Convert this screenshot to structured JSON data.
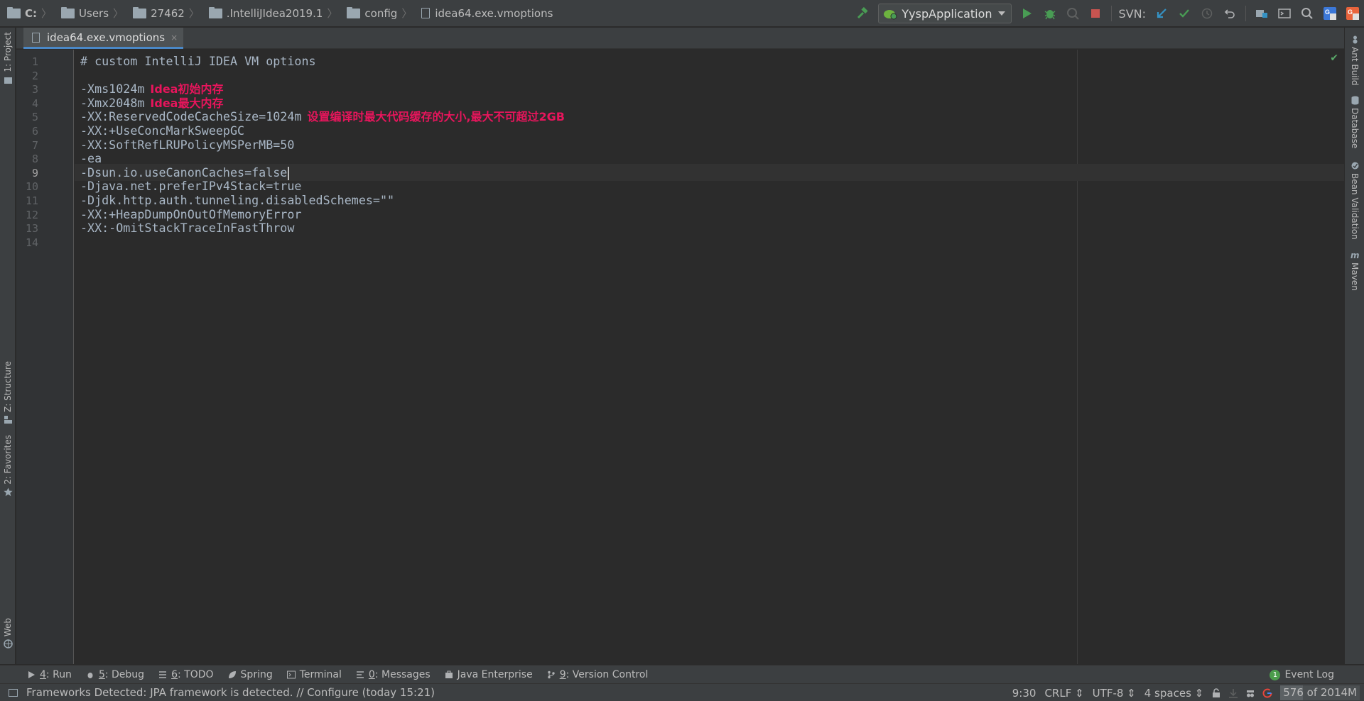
{
  "breadcrumbs": [
    {
      "label": "C:",
      "icon": "folder-icon",
      "bold": true
    },
    {
      "label": "Users",
      "icon": "folder-icon"
    },
    {
      "label": "27462",
      "icon": "folder-icon"
    },
    {
      "label": ".IntelliJIdea2019.1",
      "icon": "folder-icon"
    },
    {
      "label": "config",
      "icon": "folder-icon"
    },
    {
      "label": "idea64.exe.vmoptions",
      "icon": "file-icon"
    }
  ],
  "toolbar": {
    "run_config": "YyspApplication",
    "svn_label": "SVN:"
  },
  "left_tabs": {
    "project": "1: Project",
    "structure": "Z: Structure",
    "favorites": "2: Favorites",
    "web": "Web"
  },
  "right_tabs": {
    "ant": "Ant Build",
    "database": "Database",
    "bean": "Bean Validation",
    "maven": "Maven"
  },
  "editor_tab": {
    "label": "idea64.exe.vmoptions",
    "close": "×"
  },
  "editor": {
    "current_line": 9,
    "lines": [
      {
        "n": "1",
        "text": "# custom IntelliJ IDEA VM options",
        "ann": ""
      },
      {
        "n": "2",
        "text": "",
        "ann": ""
      },
      {
        "n": "3",
        "text": "-Xms1024m",
        "ann": "Idea初始内存"
      },
      {
        "n": "4",
        "text": "-Xmx2048m",
        "ann": "Idea最大内存"
      },
      {
        "n": "5",
        "text": "-XX:ReservedCodeCacheSize=1024m",
        "ann": "设置编译时最大代码缓存的大小,最大不可超过2GB"
      },
      {
        "n": "6",
        "text": "-XX:+UseConcMarkSweepGC",
        "ann": ""
      },
      {
        "n": "7",
        "text": "-XX:SoftRefLRUPolicyMSPerMB=50",
        "ann": ""
      },
      {
        "n": "8",
        "text": "-ea",
        "ann": ""
      },
      {
        "n": "9",
        "text": "-Dsun.io.useCanonCaches=false",
        "ann": ""
      },
      {
        "n": "10",
        "text": "-Djava.net.preferIPv4Stack=true",
        "ann": ""
      },
      {
        "n": "11",
        "text": "-Djdk.http.auth.tunneling.disabledSchemes=\"\"",
        "ann": ""
      },
      {
        "n": "12",
        "text": "-XX:+HeapDumpOnOutOfMemoryError",
        "ann": ""
      },
      {
        "n": "13",
        "text": "-XX:-OmitStackTraceInFastThrow",
        "ann": ""
      },
      {
        "n": "14",
        "text": "",
        "ann": ""
      }
    ]
  },
  "bottom_tabs": {
    "run": {
      "key": "4",
      "label": ": Run"
    },
    "debug": {
      "key": "5",
      "label": ": Debug"
    },
    "todo": {
      "key": "6",
      "label": ": TODO"
    },
    "spring": {
      "label": "Spring"
    },
    "terminal": {
      "label": "Terminal"
    },
    "messages": {
      "key": "0",
      "label": ": Messages"
    },
    "java_enterprise": {
      "label": "Java Enterprise"
    },
    "vcs": {
      "key": "9",
      "label": ": Version Control"
    },
    "event_log": {
      "label": "Event Log",
      "count": "1"
    }
  },
  "status": {
    "message": "Frameworks Detected: JPA framework is detected. // Configure (today 15:21)",
    "position": "9:30",
    "line_sep": "CRLF",
    "encoding": "UTF-8",
    "indent": "4 spaces",
    "memory_used": "576",
    "memory_rest": " of 2014M",
    "memory_fraction": 0.286
  },
  "colors": {
    "annotation": "#e8155c",
    "accent": "#4a88c7",
    "run_green": "#499c54",
    "stop_red": "#c75450"
  }
}
